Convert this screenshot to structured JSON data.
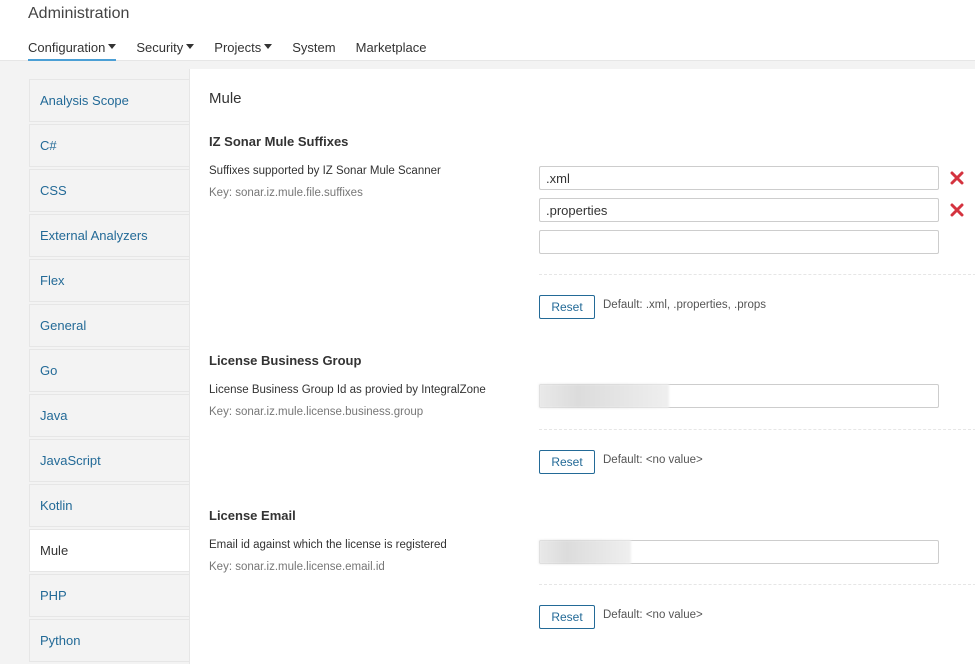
{
  "header": {
    "title": "Administration",
    "nav": [
      {
        "label": "Configuration",
        "dropdown": true,
        "active": true
      },
      {
        "label": "Security",
        "dropdown": true,
        "active": false
      },
      {
        "label": "Projects",
        "dropdown": true,
        "active": false
      },
      {
        "label": "System",
        "dropdown": false,
        "active": false
      },
      {
        "label": "Marketplace",
        "dropdown": false,
        "active": false
      }
    ]
  },
  "sidebar": {
    "items": [
      {
        "label": "Analysis Scope"
      },
      {
        "label": "C#"
      },
      {
        "label": "CSS"
      },
      {
        "label": "External Analyzers"
      },
      {
        "label": "Flex"
      },
      {
        "label": "General"
      },
      {
        "label": "Go"
      },
      {
        "label": "Java"
      },
      {
        "label": "JavaScript"
      },
      {
        "label": "Kotlin"
      },
      {
        "label": "Mule"
      },
      {
        "label": "PHP"
      },
      {
        "label": "Python"
      }
    ],
    "active_label": "Mule"
  },
  "content": {
    "title": "Mule",
    "suffixes": {
      "title": "IZ Sonar Mule Suffixes",
      "description": "Suffixes supported by IZ Sonar Mule Scanner",
      "key": "Key: sonar.iz.mule.file.suffixes",
      "values": [
        ".xml",
        ".properties",
        ""
      ],
      "reset_label": "Reset",
      "default_text": "Default: .xml, .properties, .props"
    },
    "business_group": {
      "title": "License Business Group",
      "description": "License Business Group Id as provied by IntegralZone",
      "key": "Key: sonar.iz.mule.license.business.group",
      "reset_label": "Reset",
      "default_text": "Default: <no value>"
    },
    "email": {
      "title": "License Email",
      "description": "Email id against which the license is registered",
      "key": "Key: sonar.iz.mule.license.email.id",
      "reset_label": "Reset",
      "default_text": "Default: <no value>"
    }
  },
  "colors": {
    "accent": "#4b9fd5",
    "link": "#236a97",
    "remove": "#d4333f",
    "sidebar_bg": "#f3f3f3"
  }
}
